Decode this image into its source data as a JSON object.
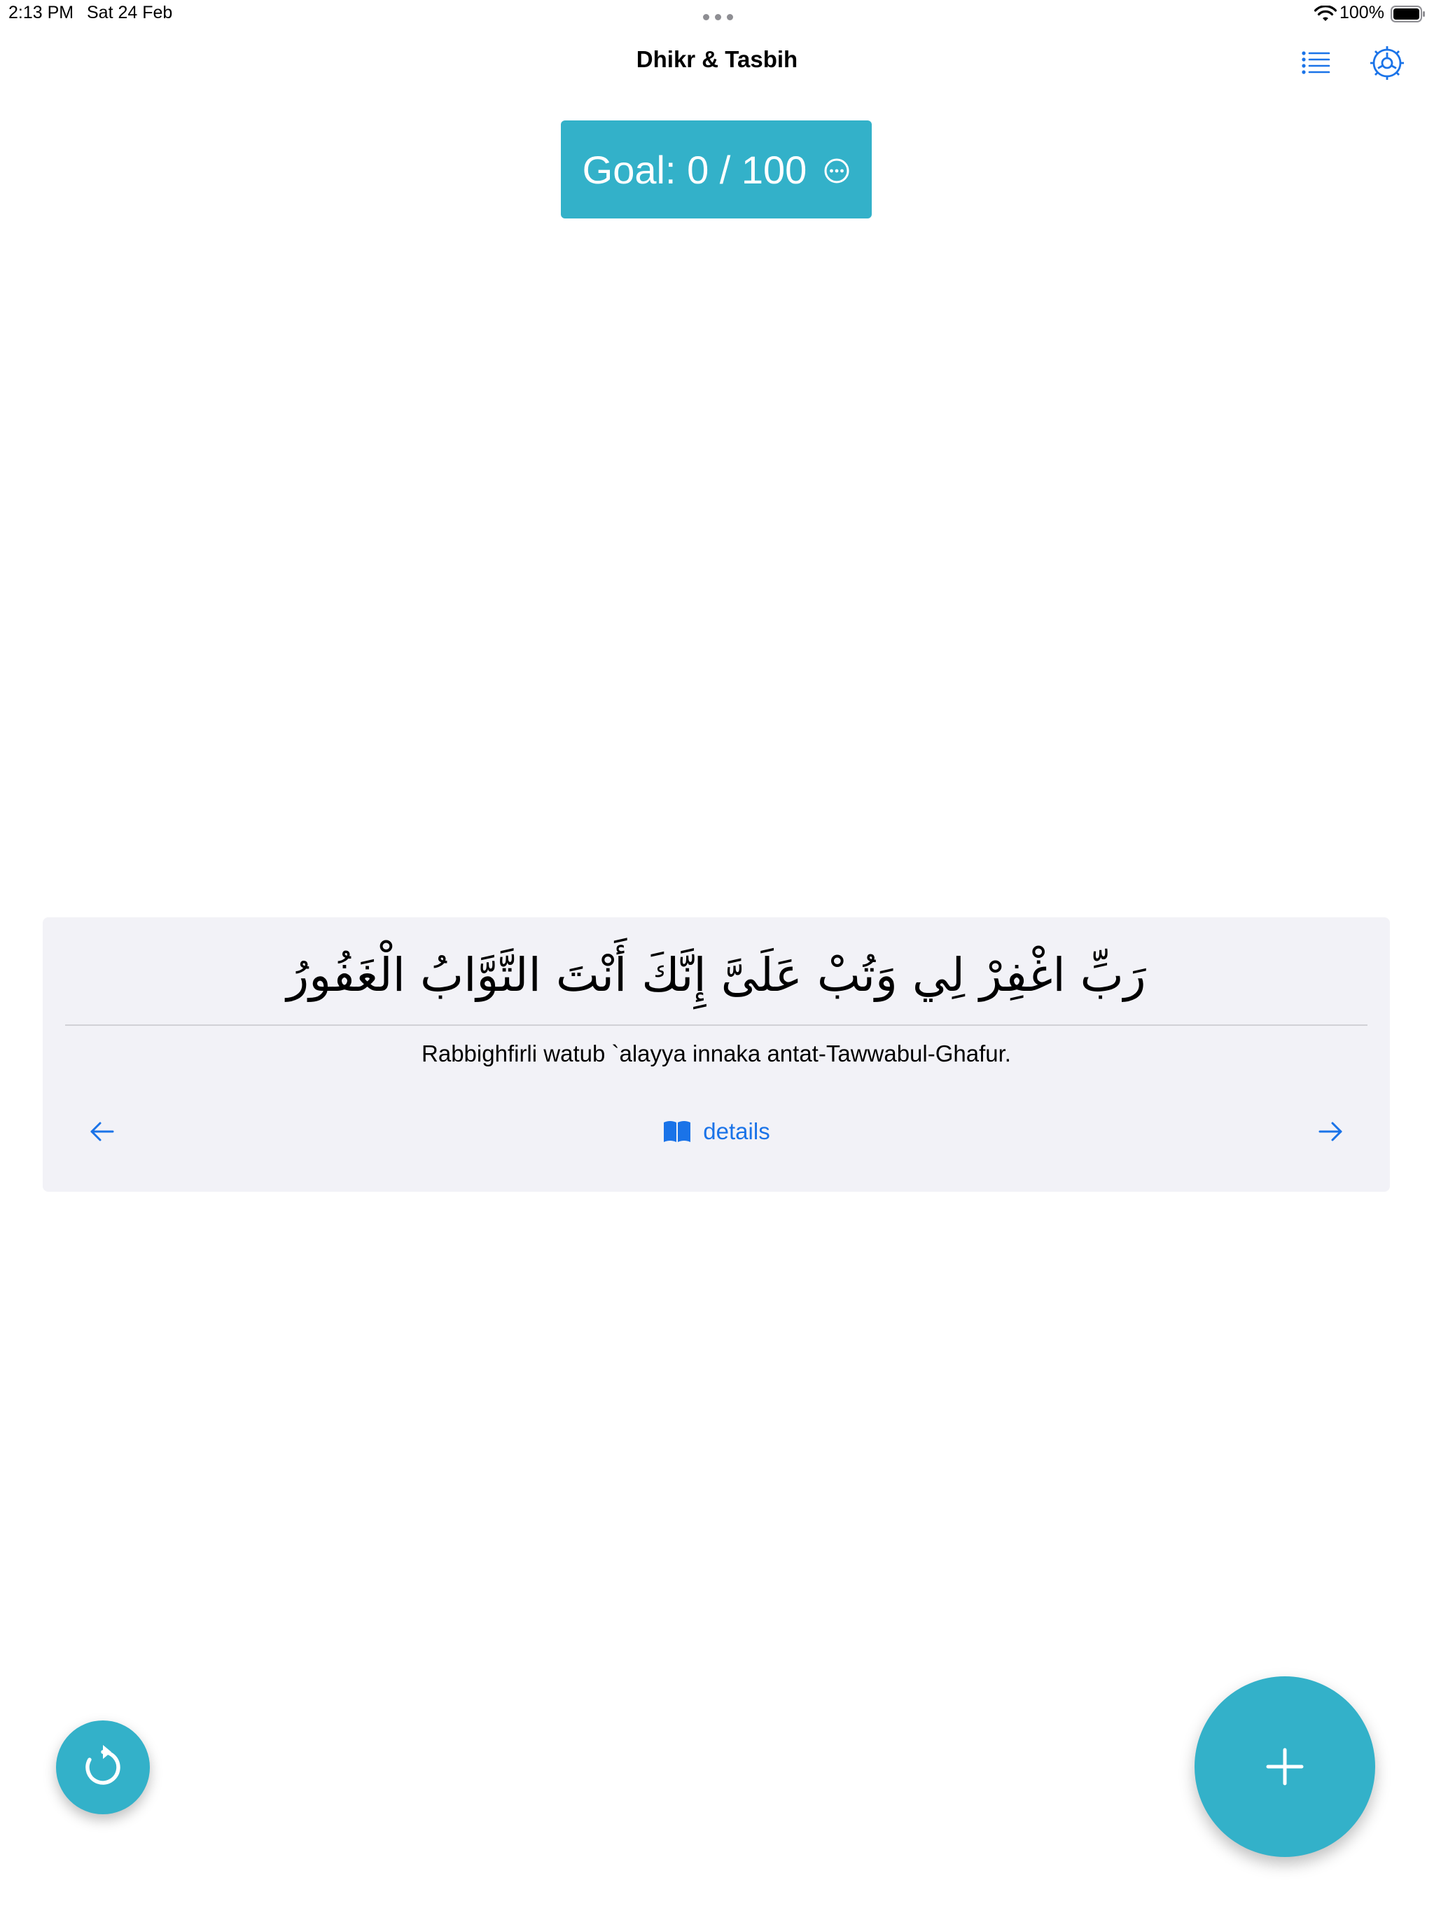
{
  "status_bar": {
    "time": "2:13 PM",
    "date": "Sat 24 Feb",
    "battery": "100%"
  },
  "nav": {
    "title": "Dhikr & Tasbih",
    "icons": [
      "list-icon",
      "gear-icon"
    ]
  },
  "goal": {
    "label": "Goal: 0 / 100",
    "icon": "ellipsis-circle-icon"
  },
  "dhikr": {
    "arabic": "رَبِّ اغْفِرْ لِي وَتُبْ عَلَىَّ إِنَّكَ أَنْتَ التَّوَّابُ الْغَفُورُ",
    "transliteration": "Rabbighfirli watub `alayya innaka antat-Tawwabul-Ghafur.",
    "details_label": "details",
    "icons": [
      "arrow-left-icon",
      "book-icon",
      "arrow-right-icon"
    ]
  },
  "actions": {
    "reset_icon": "reset-icon",
    "add_icon": "plus-icon"
  },
  "colors": {
    "accent": "#33b1c9",
    "link_blue": "#1a73e8",
    "card_background": "#f2f2f7"
  }
}
